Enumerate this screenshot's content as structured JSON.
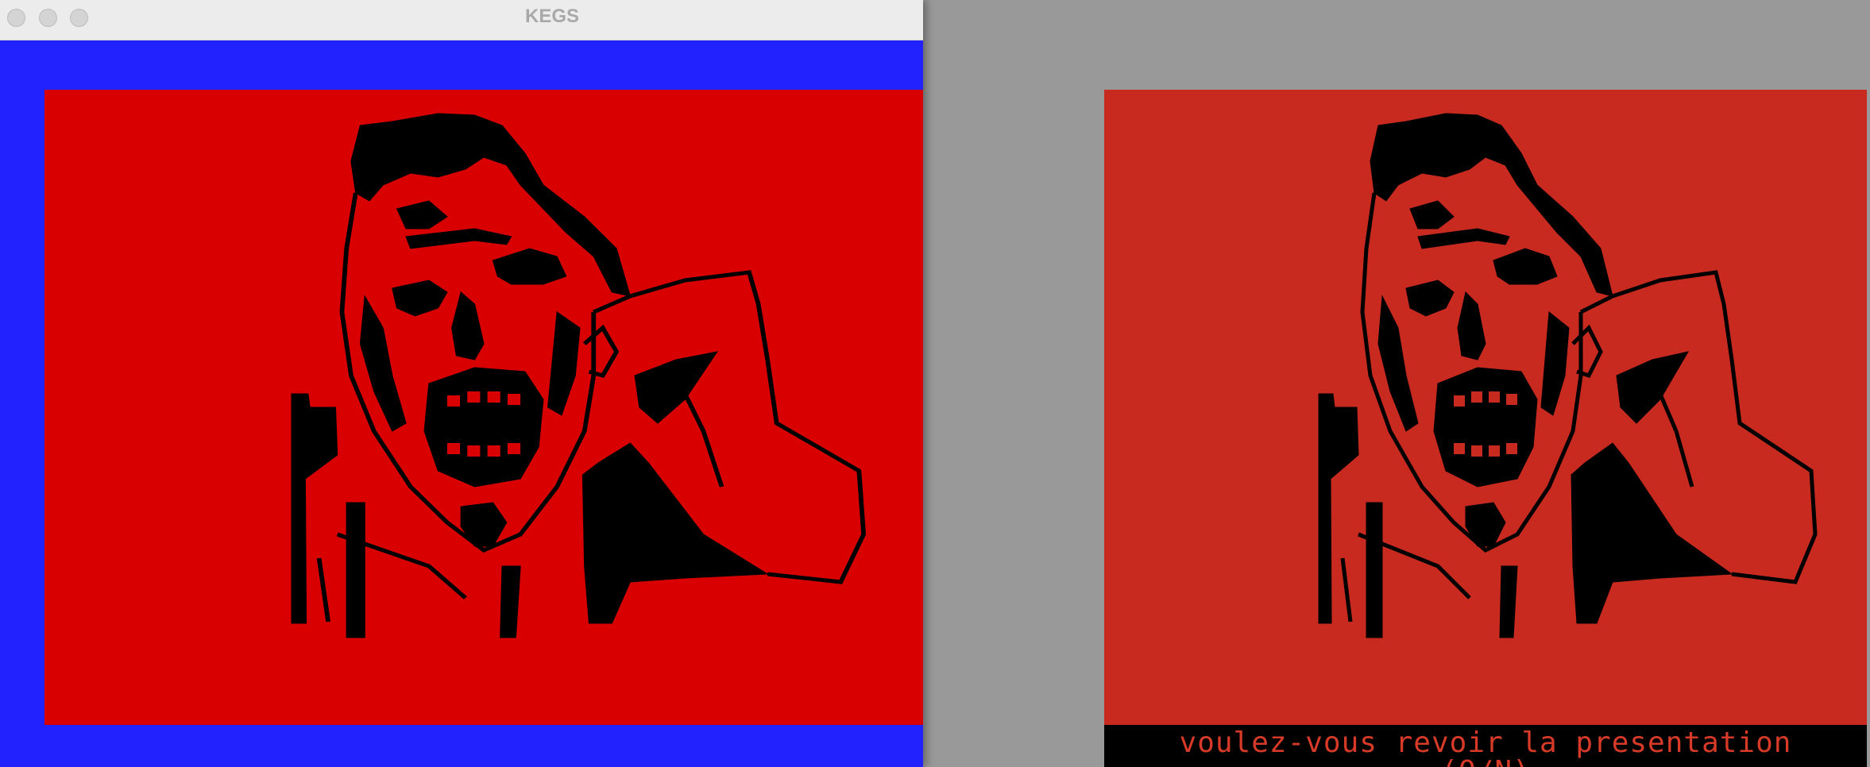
{
  "window": {
    "title": "KEGS"
  },
  "emulator": {
    "status_line_1": "voulez-vous revoir la presentation",
    "status_line_2": "(O/N)"
  },
  "icons": {
    "close": "close-dot-icon",
    "minimize": "minimize-dot-icon",
    "maximize": "maximize-dot-icon"
  },
  "colors": {
    "kegs_border": "#2222ff",
    "left_screen_red": "#d80000",
    "right_screen_red": "#c82a1f",
    "desktop_gray": "#999999",
    "ink": "#000000"
  }
}
